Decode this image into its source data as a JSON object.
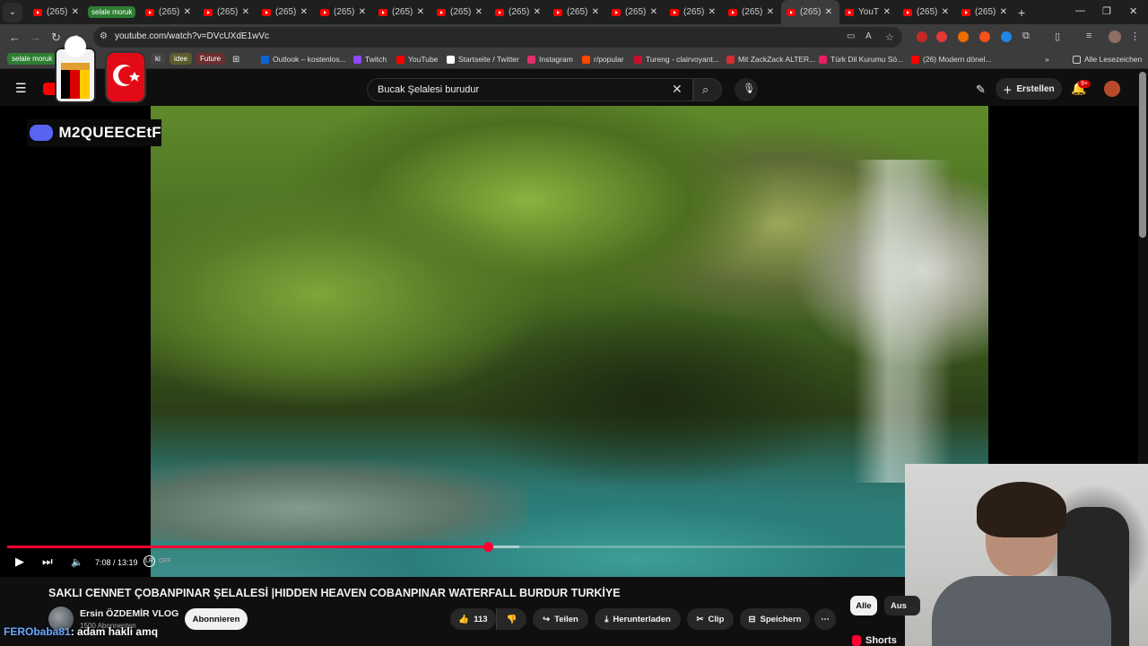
{
  "browser": {
    "tab_label": "(265)",
    "group_label": "selale moruk",
    "active_short_label": "YouT",
    "tab_count_left": 13,
    "tab_count_right": 3,
    "url": "youtube.com/watch?v=DVcUXdE1wVc"
  },
  "bookmarks": {
    "group1": "selale moruk",
    "group2": "ki",
    "group3": "idee",
    "group4": "Future",
    "items": [
      {
        "label": "Outlook – kostenlos...",
        "color": "#0a64d6"
      },
      {
        "label": "Twitch",
        "color": "#9146ff"
      },
      {
        "label": "YouTube",
        "color": "#ff0000"
      },
      {
        "label": "Startseite / Twitter",
        "color": "#ffffff"
      },
      {
        "label": "Instagram",
        "color": "#e1306c"
      },
      {
        "label": "r/popular",
        "color": "#ff4500"
      },
      {
        "label": "Tureng - clairvoyant...",
        "color": "#c8102e"
      },
      {
        "label": "Mit ZackZack ALTER...",
        "color": "#d32f2f"
      },
      {
        "label": "Türk Dil Kurumu Sö...",
        "color": "#e91e63"
      },
      {
        "label": "(26) Modern dönel...",
        "color": "#ff0000"
      }
    ],
    "all_bookmarks": "Alle Lesezeichen",
    "more": "»"
  },
  "youtube_header": {
    "search_value": "Bucak Şelalesi burudur",
    "create_label": "Erstellen",
    "notifications_badge": "9+"
  },
  "player": {
    "time": "7:08 / 13:19",
    "progress": 0.535,
    "buffered": 0.57,
    "autoplay_label": "OFF"
  },
  "overlay": {
    "discord_name": "M2QUEECEtF"
  },
  "video_info": {
    "title": "SAKLI CENNET ÇOBANPINAR ŞELALESİ |HIDDEN HEAVEN COBANPINAR WATERFALL BURDUR TURKİYE",
    "channel": "Ersin ÖZDEMİR VLOG",
    "subscribers": "1500 Abonnenten",
    "subscribe_label": "Abonnieren",
    "likes": "113",
    "share_label": "Teilen",
    "download_label": "Herunterladen",
    "clip_label": "Clip",
    "save_label": "Speichern"
  },
  "chat_overlay": {
    "user": "FERObaba81",
    "message": ": adam hakli amq"
  },
  "sidebar": {
    "chip_all": "Alle",
    "chip_second": "Aus",
    "shorts_label": "Shorts"
  },
  "colors": {
    "accent_red": "#ff0033",
    "background": "#0f0f0f"
  }
}
